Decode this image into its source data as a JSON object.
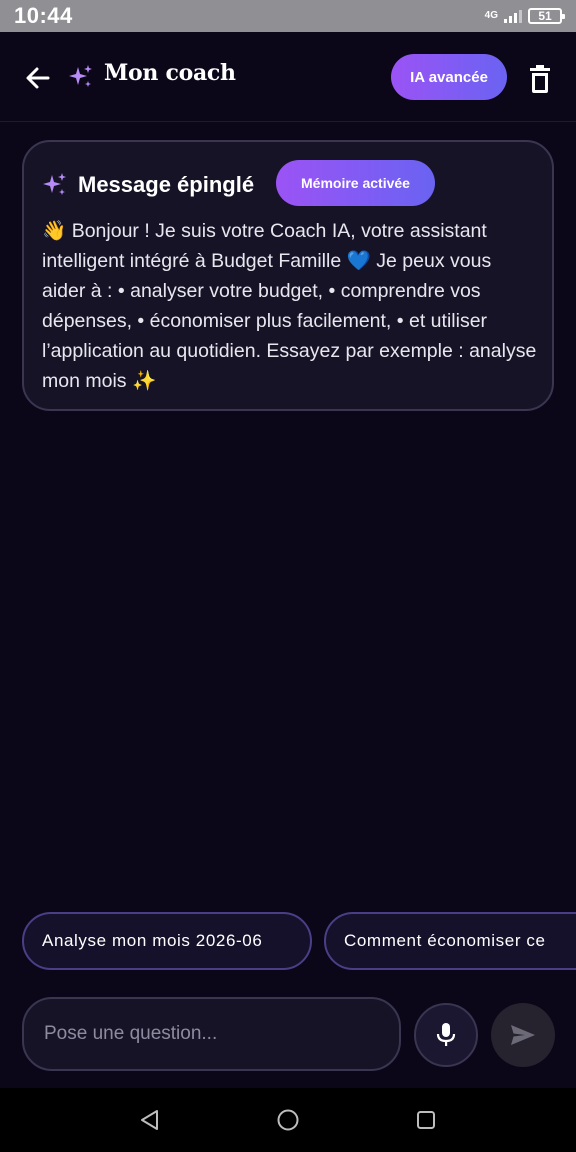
{
  "status_bar": {
    "time": "10:44",
    "network": "4G",
    "battery": "51"
  },
  "header": {
    "title": "Mon coach",
    "badge": "IA avancée"
  },
  "pinned": {
    "title": "Message épinglé",
    "badge": "Mémoire activée",
    "message": "👋 Bonjour ! Je suis votre Coach IA, votre assistant intelligent intégré à Budget Famille 💙 Je peux vous aider à : • analyser votre budget, • comprendre vos dépenses, • économiser plus facilement, • et utiliser l’application au quotidien. Essayez par exemple : analyse mon mois ✨"
  },
  "suggestions": [
    "Analyse mon mois 2026-06",
    "Comment économiser ce"
  ],
  "input": {
    "placeholder": "Pose une question..."
  },
  "colors": {
    "background": "#0b0719",
    "accent_start": "#9b53f5",
    "accent_end": "#6a63f2",
    "spark": "#b78cf7"
  }
}
